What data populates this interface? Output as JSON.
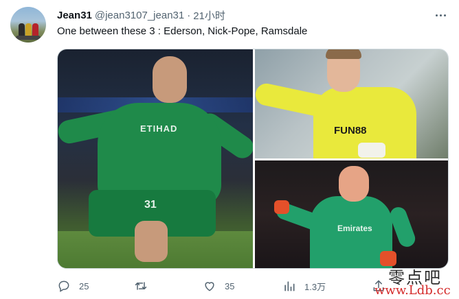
{
  "tweet": {
    "author_name": "Jean31",
    "author_handle": "@jean3107_jean31",
    "separator": "·",
    "time": "21小时",
    "text": "One between these 3 : Ederson, Nick-Pope, Ramsdale"
  },
  "media": {
    "left": {
      "jersey_text": "ETIHAD",
      "number": "31"
    },
    "top_right": {
      "sponsor": "FUN88"
    },
    "bottom_right": {
      "sponsor": "Emirates"
    }
  },
  "actions": {
    "reply_count": "25",
    "retweet_count": "",
    "like_count": "35",
    "views_count": "1.3万"
  },
  "watermark": {
    "top": "零点吧",
    "bottom": "www.Ldb.cc"
  },
  "icons": {
    "reply": "reply-icon",
    "retweet": "retweet-icon",
    "like": "heart-icon",
    "views": "views-icon",
    "share": "share-icon",
    "more": "more-icon"
  },
  "colors": {
    "text_secondary": "#536471",
    "text_primary": "#0f1419",
    "watermark_red": "#d42a2a"
  }
}
